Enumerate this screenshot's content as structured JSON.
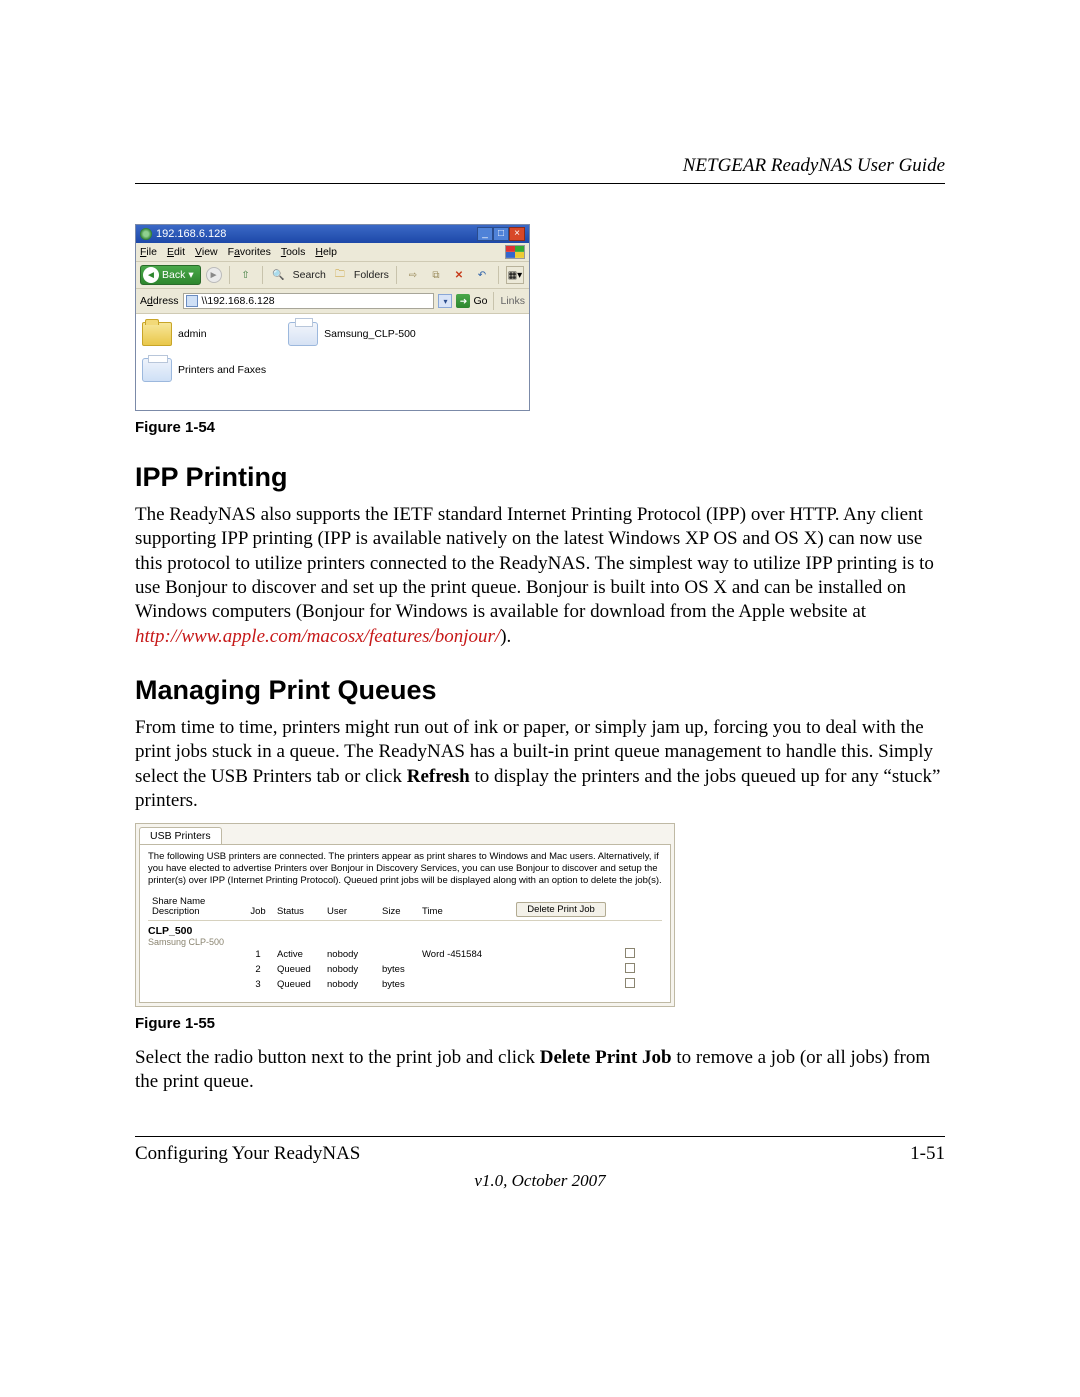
{
  "header": {
    "title": "NETGEAR ReadyNAS User Guide"
  },
  "fig54": {
    "caption": "Figure 1-54",
    "titlebar": {
      "ip": "192.168.6.128"
    },
    "menu": {
      "file": "File",
      "edit": "Edit",
      "view": "View",
      "favorites": "Favorites",
      "tools": "Tools",
      "help": "Help"
    },
    "toolbar": {
      "back": "Back",
      "search": "Search",
      "folders": "Folders"
    },
    "addressbar": {
      "label": "Address",
      "value": "\\\\192.168.6.128",
      "go": "Go",
      "links": "Links"
    },
    "items": {
      "admin": "admin",
      "printers_faxes": "Printers and Faxes",
      "printer": "Samsung_CLP-500"
    }
  },
  "ipp": {
    "heading": "IPP Printing",
    "para_a": "The ReadyNAS also supports the IETF standard Internet Printing Protocol (IPP) over HTTP. Any client supporting IPP printing (IPP is available natively on the latest Windows XP OS and OS X) can now use this protocol to utilize printers connected to the ReadyNAS. The simplest way to utilize IPP printing is to use Bonjour to discover and set up the print queue. Bonjour is built into OS X and can be installed on Windows computers (Bonjour for Windows is available for download from the Apple website at ",
    "link": "http://www.apple.com/macosx/features/bonjour/",
    "para_b": ")."
  },
  "mpq": {
    "heading": "Managing Print Queues",
    "para1_a": "From time to time, printers might run out of ink or paper, or simply jam up, forcing you to deal with the print jobs stuck in a queue. The ReadyNAS has a built-in print queue management to handle this. Simply select the USB Printers tab or click ",
    "para1_bold": "Refresh",
    "para1_b": " to display the printers and the jobs queued up for any “stuck” printers."
  },
  "fig55": {
    "caption": "Figure 1-55",
    "tab": "USB Printers",
    "desc": "The following USB printers are connected. The printers appear as print shares to Windows and Mac users. Alternatively, if you have elected to advertise Printers over Bonjour in Discovery Services, you can use Bonjour to discover and setup the printer(s) over IPP (Internet Printing Protocol). Queued print jobs will be displayed along with an option to delete the job(s).",
    "cols": {
      "share": "Share Name Description",
      "job": "Job",
      "status": "Status",
      "user": "User",
      "size": "Size",
      "time": "Time"
    },
    "delete_btn": "Delete Print Job",
    "printer": {
      "name": "CLP_500",
      "sub": "Samsung CLP-500"
    },
    "rows": [
      {
        "job": "1",
        "status": "Active",
        "user": "nobody",
        "size": "",
        "time": "Word -451584"
      },
      {
        "job": "2",
        "status": "Queued",
        "user": "nobody",
        "size": "bytes",
        "time": ""
      },
      {
        "job": "3",
        "status": "Queued",
        "user": "nobody",
        "size": "bytes",
        "time": ""
      }
    ]
  },
  "after55": {
    "para_a": "Select the radio button next to the print job and click ",
    "bold": "Delete Print Job",
    "para_b": " to remove a job (or all jobs) from the print queue."
  },
  "footer": {
    "left": "Configuring Your ReadyNAS",
    "right": "1-51",
    "version": "v1.0, October 2007"
  }
}
